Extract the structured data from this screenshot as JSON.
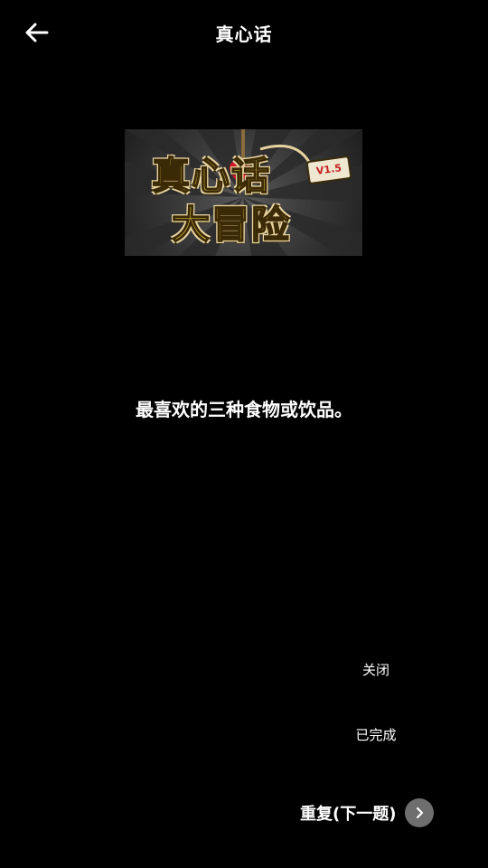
{
  "header": {
    "title": "真心话"
  },
  "logo": {
    "line1": "真心话",
    "line2": "大冒险",
    "tag": "V1.5"
  },
  "question": {
    "text": "最喜欢的三种食物或饮品。"
  },
  "actions": {
    "close_label": "关闭",
    "done_label": "已完成",
    "next_label": "重复(下一题)"
  },
  "colors": {
    "background": "#000000",
    "text": "#ffffff",
    "next_icon_bg": "#6e6e6e",
    "logo_text": "#f1d44b"
  }
}
